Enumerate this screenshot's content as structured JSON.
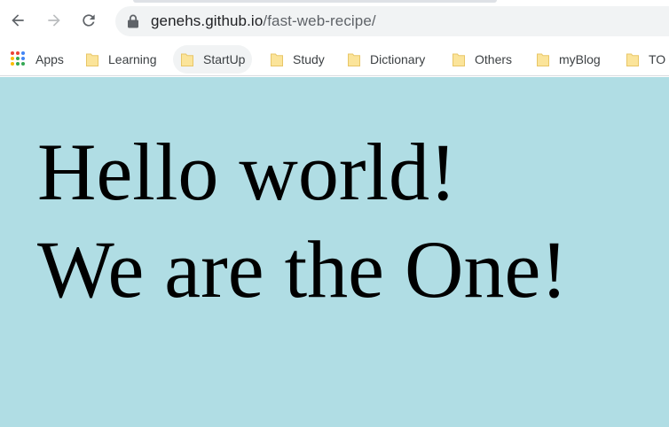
{
  "browser": {
    "url_host": "genehs.github.io",
    "url_path": "/fast-web-recipe/"
  },
  "bookmarks": [
    {
      "label": "Apps",
      "icon": "apps-grid-icon"
    },
    {
      "label": "Learning",
      "icon": "folder-icon"
    },
    {
      "label": "StartUp",
      "icon": "folder-icon"
    },
    {
      "label": "Study",
      "icon": "folder-icon"
    },
    {
      "label": "Dictionary",
      "icon": "folder-icon"
    },
    {
      "label": "Others",
      "icon": "folder-icon"
    },
    {
      "label": "myBlog",
      "icon": "folder-icon"
    },
    {
      "label": "TO",
      "icon": "folder-icon"
    }
  ],
  "page": {
    "background": "#b0dde4",
    "line1": "Hello world!",
    "line2": "We are the One!"
  },
  "colors": {
    "folder": "#fbe49a",
    "folder_stroke": "#e8c667",
    "icon_gray": "#5f6368",
    "omnibox": "#f1f3f4"
  }
}
